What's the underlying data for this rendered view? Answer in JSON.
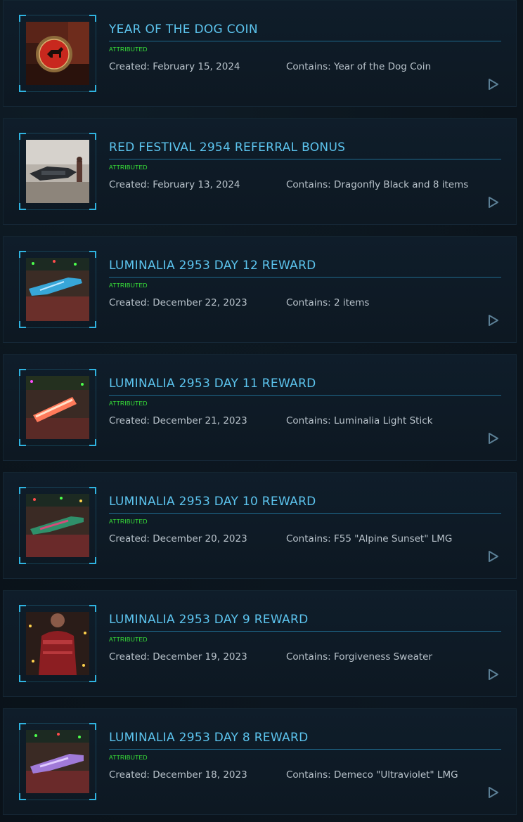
{
  "items": [
    {
      "title": "YEAR OF THE DOG COIN",
      "status": "ATTRIBUTED",
      "created": "Created: February 15, 2024",
      "contains": "Contains: Year of the Dog Coin",
      "thumb": "dog-coin"
    },
    {
      "title": "RED FESTIVAL 2954 REFERRAL BONUS",
      "status": "ATTRIBUTED",
      "created": "Created: February 13, 2024",
      "contains": "Contains: Dragonfly Black and 8 items",
      "thumb": "dragonfly"
    },
    {
      "title": "LUMINALIA 2953 DAY 12 REWARD",
      "status": "ATTRIBUTED",
      "created": "Created: December 22, 2023",
      "contains": "Contains: 2 items",
      "thumb": "blue-rifle"
    },
    {
      "title": "LUMINALIA 2953 DAY 11 REWARD",
      "status": "ATTRIBUTED",
      "created": "Created: December 21, 2023",
      "contains": "Contains: Luminalia Light Stick",
      "thumb": "light-stick"
    },
    {
      "title": "LUMINALIA 2953 DAY 10 REWARD",
      "status": "ATTRIBUTED",
      "created": "Created: December 20, 2023",
      "contains": "Contains: F55 \"Alpine Sunset\" LMG",
      "thumb": "green-lmg"
    },
    {
      "title": "LUMINALIA 2953 DAY 9 REWARD",
      "status": "ATTRIBUTED",
      "created": "Created: December 19, 2023",
      "contains": "Contains: Forgiveness Sweater",
      "thumb": "sweater"
    },
    {
      "title": "LUMINALIA 2953 DAY 8 REWARD",
      "status": "ATTRIBUTED",
      "created": "Created: December 18, 2023",
      "contains": "Contains: Demeco \"Ultraviolet\" LMG",
      "thumb": "purple-lmg"
    }
  ],
  "colors": {
    "title": "#5cc4ee",
    "status": "#39e639",
    "bracket": "#2fb3e0"
  }
}
